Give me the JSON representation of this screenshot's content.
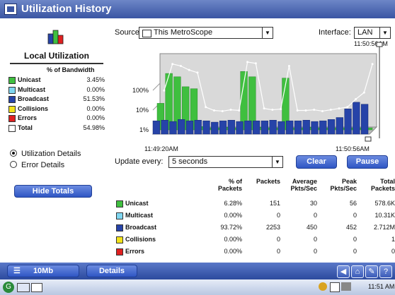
{
  "window": {
    "title": "Utilization History"
  },
  "sidebar": {
    "heading": "Local Utilization",
    "pct_header": "% of Bandwidth",
    "rows": [
      {
        "name": "Unicast",
        "value": "3.45%",
        "color": "#3fbf3f"
      },
      {
        "name": "Multicast",
        "value": "0.00%",
        "color": "#7fd6f0"
      },
      {
        "name": "Broadcast",
        "value": "51.53%",
        "color": "#2643a8"
      },
      {
        "name": "Collisions",
        "value": "0.00%",
        "color": "#f2e21b"
      },
      {
        "name": "Errors",
        "value": "0.00%",
        "color": "#e02020"
      },
      {
        "name": "Total",
        "value": "54.98%",
        "color": "#ffffff"
      }
    ],
    "radio_util": "Utilization Details",
    "radio_err": "Error Details",
    "hide_totals": "Hide Totals"
  },
  "source": {
    "label": "Source:",
    "value": "This MetroScope"
  },
  "interface": {
    "label": "Interface:",
    "value": "LAN"
  },
  "chart_data": {
    "type": "bar",
    "y_ticks": [
      "100%",
      "10%",
      "1%"
    ],
    "time_top_right": "11:50:56AM",
    "x_start": "11:49:20AM",
    "x_end": "11:50:56AM",
    "series": [
      {
        "name": "Broadcast",
        "values": [
          20,
          21,
          19,
          22,
          20,
          21,
          20,
          18,
          20,
          21,
          19,
          20,
          20,
          20,
          21,
          19,
          20,
          20,
          21,
          19,
          20,
          22,
          25,
          38,
          48,
          45
        ]
      },
      {
        "name": "Unicast",
        "values": [
          40,
          85,
          80,
          65,
          62,
          5,
          3,
          3,
          4,
          3,
          88,
          80,
          4,
          3,
          3,
          78,
          3,
          3,
          4,
          3,
          3,
          3,
          3,
          3,
          3,
          3
        ]
      }
    ],
    "total_line": [
      55,
      95,
      92,
      86,
      82,
      30,
      25,
      24,
      26,
      25,
      98,
      96,
      28,
      26,
      27,
      92,
      25,
      25,
      26,
      24,
      26,
      28,
      30,
      42,
      52,
      95
    ]
  },
  "controls": {
    "update_label": "Update every:",
    "update_value": "5 seconds",
    "clear": "Clear",
    "pause": "Pause"
  },
  "table": {
    "headers": [
      {
        "l1": "% of",
        "l2": "Packets"
      },
      {
        "l1": "",
        "l2": "Packets"
      },
      {
        "l1": "Average",
        "l2": "Pkts/Sec"
      },
      {
        "l1": "Peak",
        "l2": "Pkts/Sec"
      },
      {
        "l1": "Total",
        "l2": "Packets"
      }
    ],
    "rows": [
      {
        "name": "Unicast",
        "color": "#3fbf3f",
        "cells": [
          "6.28%",
          "151",
          "30",
          "56",
          "578.6K"
        ]
      },
      {
        "name": "Multicast",
        "color": "#7fd6f0",
        "cells": [
          "0.00%",
          "0",
          "0",
          "0",
          "10.31K"
        ]
      },
      {
        "name": "Broadcast",
        "color": "#2643a8",
        "cells": [
          "93.72%",
          "2253",
          "450",
          "452",
          "2.712M"
        ]
      },
      {
        "name": "Collisions",
        "color": "#f2e21b",
        "cells": [
          "0.00%",
          "0",
          "0",
          "0",
          "1"
        ]
      },
      {
        "name": "Errors",
        "color": "#e02020",
        "cells": [
          "0.00%",
          "0",
          "0",
          "0",
          "0"
        ]
      }
    ]
  },
  "statusbar": {
    "speed": "10Mb",
    "details": "Details"
  },
  "taskbar": {
    "clock": "11:51 AM"
  }
}
